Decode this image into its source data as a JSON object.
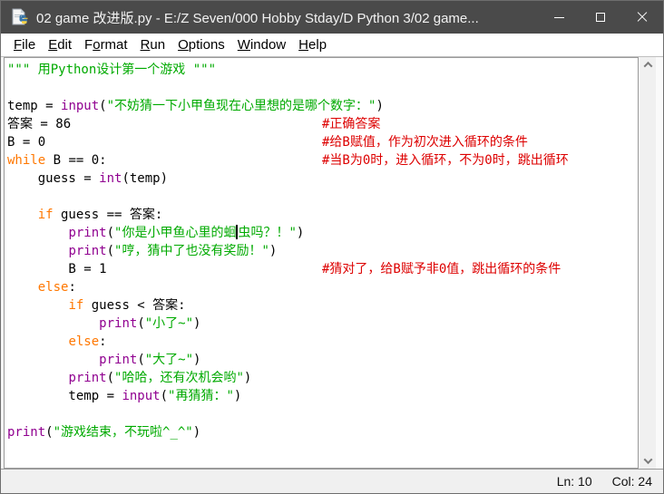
{
  "window": {
    "title": "02 game 改进版.py - E:/Z Seven/000 Hobby Stday/D Python 3/02 game...",
    "icon": "python-file-icon",
    "controls": {
      "minimize": "minimize",
      "maximize": "maximize",
      "close": "close"
    }
  },
  "colors": {
    "titlebar_bg": "#4a4a4a",
    "keyword": "#ff7700",
    "builtin": "#900090",
    "string": "#00aa00",
    "comment": "#dd0000",
    "editor_bg": "#ffffff"
  },
  "menu": {
    "items": [
      {
        "label": "File",
        "underline": 0
      },
      {
        "label": "Edit",
        "underline": 0
      },
      {
        "label": "Format",
        "underline": 1
      },
      {
        "label": "Run",
        "underline": 0
      },
      {
        "label": "Options",
        "underline": 0
      },
      {
        "label": "Window",
        "underline": 0
      },
      {
        "label": "Help",
        "underline": 0
      }
    ]
  },
  "editor": {
    "lines": [
      {
        "seg": [
          {
            "t": "\"\"\" 用Python设计第一个游戏 \"\"\"",
            "c": "str"
          }
        ]
      },
      {
        "seg": []
      },
      {
        "seg": [
          {
            "t": "temp = ",
            "c": "pl"
          },
          {
            "t": "input",
            "c": "bi"
          },
          {
            "t": "(",
            "c": "pl"
          },
          {
            "t": "\"不妨猜一下小甲鱼现在心里想的是哪个数字：\"",
            "c": "str"
          },
          {
            "t": ")",
            "c": "pl"
          }
        ]
      },
      {
        "seg": [
          {
            "t": "答案 = 86",
            "c": "pl"
          }
        ],
        "comment": "#正确答案"
      },
      {
        "seg": [
          {
            "t": "B = 0",
            "c": "pl"
          }
        ],
        "comment": "#给B赋值，作为初次进入循环的条件"
      },
      {
        "seg": [
          {
            "t": "while",
            "c": "kw"
          },
          {
            "t": " B == 0:",
            "c": "pl"
          }
        ],
        "comment": "#当B为0时，进入循环，不为0时，跳出循环"
      },
      {
        "seg": [
          {
            "t": "    guess = ",
            "c": "pl"
          },
          {
            "t": "int",
            "c": "bi"
          },
          {
            "t": "(temp)",
            "c": "pl"
          }
        ]
      },
      {
        "seg": []
      },
      {
        "seg": [
          {
            "t": "    ",
            "c": "pl"
          },
          {
            "t": "if",
            "c": "kw"
          },
          {
            "t": " guess == 答案:",
            "c": "pl"
          }
        ]
      },
      {
        "seg": [
          {
            "t": "        ",
            "c": "pl"
          },
          {
            "t": "print",
            "c": "bi"
          },
          {
            "t": "(",
            "c": "pl"
          },
          {
            "t": "\"你是小甲鱼心里的蛔",
            "c": "str"
          },
          {
            "cursor": true
          },
          {
            "t": "虫吗？！\"",
            "c": "str"
          },
          {
            "t": ")",
            "c": "pl"
          }
        ]
      },
      {
        "seg": [
          {
            "t": "        ",
            "c": "pl"
          },
          {
            "t": "print",
            "c": "bi"
          },
          {
            "t": "(",
            "c": "pl"
          },
          {
            "t": "\"哼，猜中了也没有奖励！\"",
            "c": "str"
          },
          {
            "t": ")",
            "c": "pl"
          }
        ]
      },
      {
        "seg": [
          {
            "t": "        B = 1",
            "c": "pl"
          }
        ],
        "comment": "#猜对了，给B赋予非0值，跳出循环的条件"
      },
      {
        "seg": [
          {
            "t": "    ",
            "c": "pl"
          },
          {
            "t": "else",
            "c": "kw"
          },
          {
            "t": ":",
            "c": "pl"
          }
        ]
      },
      {
        "seg": [
          {
            "t": "        ",
            "c": "pl"
          },
          {
            "t": "if",
            "c": "kw"
          },
          {
            "t": " guess < 答案:",
            "c": "pl"
          }
        ]
      },
      {
        "seg": [
          {
            "t": "            ",
            "c": "pl"
          },
          {
            "t": "print",
            "c": "bi"
          },
          {
            "t": "(",
            "c": "pl"
          },
          {
            "t": "\"小了~\"",
            "c": "str"
          },
          {
            "t": ")",
            "c": "pl"
          }
        ]
      },
      {
        "seg": [
          {
            "t": "        ",
            "c": "pl"
          },
          {
            "t": "else",
            "c": "kw"
          },
          {
            "t": ":",
            "c": "pl"
          }
        ]
      },
      {
        "seg": [
          {
            "t": "            ",
            "c": "pl"
          },
          {
            "t": "print",
            "c": "bi"
          },
          {
            "t": "(",
            "c": "pl"
          },
          {
            "t": "\"大了~\"",
            "c": "str"
          },
          {
            "t": ")",
            "c": "pl"
          }
        ]
      },
      {
        "seg": [
          {
            "t": "        ",
            "c": "pl"
          },
          {
            "t": "print",
            "c": "bi"
          },
          {
            "t": "(",
            "c": "pl"
          },
          {
            "t": "\"哈哈，还有次机会哟\"",
            "c": "str"
          },
          {
            "t": ")",
            "c": "pl"
          }
        ]
      },
      {
        "seg": [
          {
            "t": "        temp = ",
            "c": "pl"
          },
          {
            "t": "input",
            "c": "bi"
          },
          {
            "t": "(",
            "c": "pl"
          },
          {
            "t": "\"再猜猜：\"",
            "c": "str"
          },
          {
            "t": ")",
            "c": "pl"
          }
        ]
      },
      {
        "seg": []
      },
      {
        "seg": [
          {
            "t": "print",
            "c": "bi"
          },
          {
            "t": "(",
            "c": "pl"
          },
          {
            "t": "\"游戏结束，不玩啦^_^\"",
            "c": "str"
          },
          {
            "t": ")",
            "c": "pl"
          }
        ]
      }
    ]
  },
  "status": {
    "line": "Ln: 10",
    "column": "Col: 24"
  }
}
